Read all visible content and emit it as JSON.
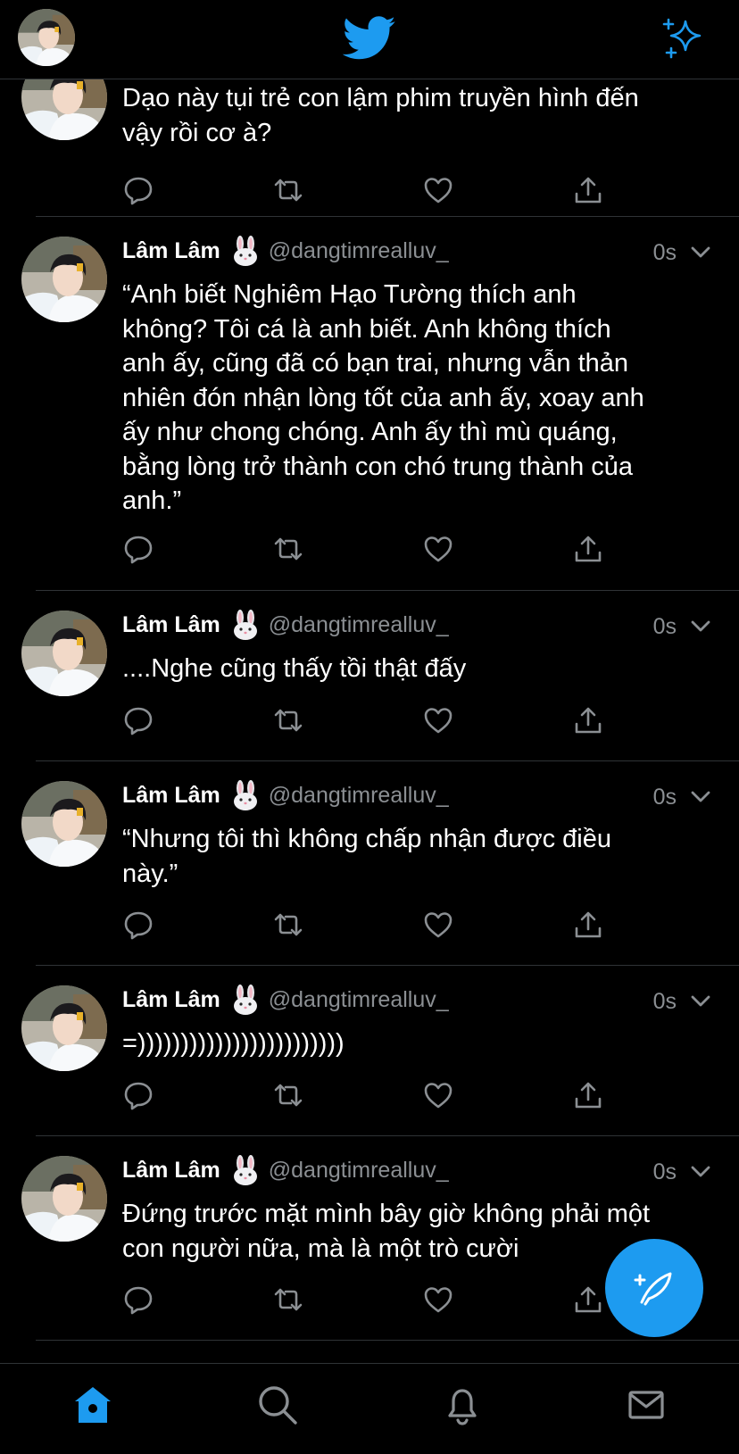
{
  "colors": {
    "accent": "#1d9bf0",
    "background": "#000000",
    "secondary_text": "#8b8f93",
    "divider": "#2f3336"
  },
  "header": {
    "logo_icon": "twitter-bird-icon",
    "sparkle_icon": "sparkle-icon",
    "avatar_icon": "avatar"
  },
  "tweets": [
    {
      "name": "",
      "handle": "",
      "time": "",
      "text": "Dạo này tụi trẻ con lậm phim truyền hình đến\nvậy rồi cơ à?"
    },
    {
      "name": "Lâm Lâm",
      "emoji": "rabbit-face-icon",
      "handle": "@dangtimrealluv_",
      "time": "0s",
      "text": "“Anh biết Nghiêm Hạo Tường thích anh\nkhông? Tôi cá là anh biết. Anh không thích\nanh ấy, cũng đã có bạn trai, nhưng vẫn thản\nnhiên đón nhận lòng tốt của anh ấy, xoay anh\nấy như chong chóng. Anh ấy thì mù quáng,\nbằng lòng trở thành con chó trung thành của\nanh.”"
    },
    {
      "name": "Lâm Lâm",
      "emoji": "rabbit-face-icon",
      "handle": "@dangtimrealluv_",
      "time": "0s",
      "text": "....Nghe cũng thấy tồi thật đấy"
    },
    {
      "name": "Lâm Lâm",
      "emoji": "rabbit-face-icon",
      "handle": "@dangtimrealluv_",
      "time": "0s",
      "text": "“Nhưng tôi thì không chấp nhận được điều\nnày.”"
    },
    {
      "name": "Lâm Lâm",
      "emoji": "rabbit-face-icon",
      "handle": "@dangtimrealluv_",
      "time": "0s",
      "text": "=))))))))))))))))))))))))"
    },
    {
      "name": "Lâm Lâm",
      "emoji": "rabbit-face-icon",
      "handle": "@dangtimrealluv_",
      "time": "0s",
      "text": "Đứng trước mặt mình bây giờ không phải một\ncon người nữa, mà là một trò cười"
    }
  ],
  "action_icons": [
    "reply-icon",
    "retweet-icon",
    "like-icon",
    "share-icon"
  ],
  "fab": {
    "icon": "compose-tweet-icon"
  },
  "tabbar": {
    "items": [
      "home-icon",
      "search-icon",
      "notifications-icon",
      "messages-icon"
    ],
    "active": "home-icon"
  }
}
